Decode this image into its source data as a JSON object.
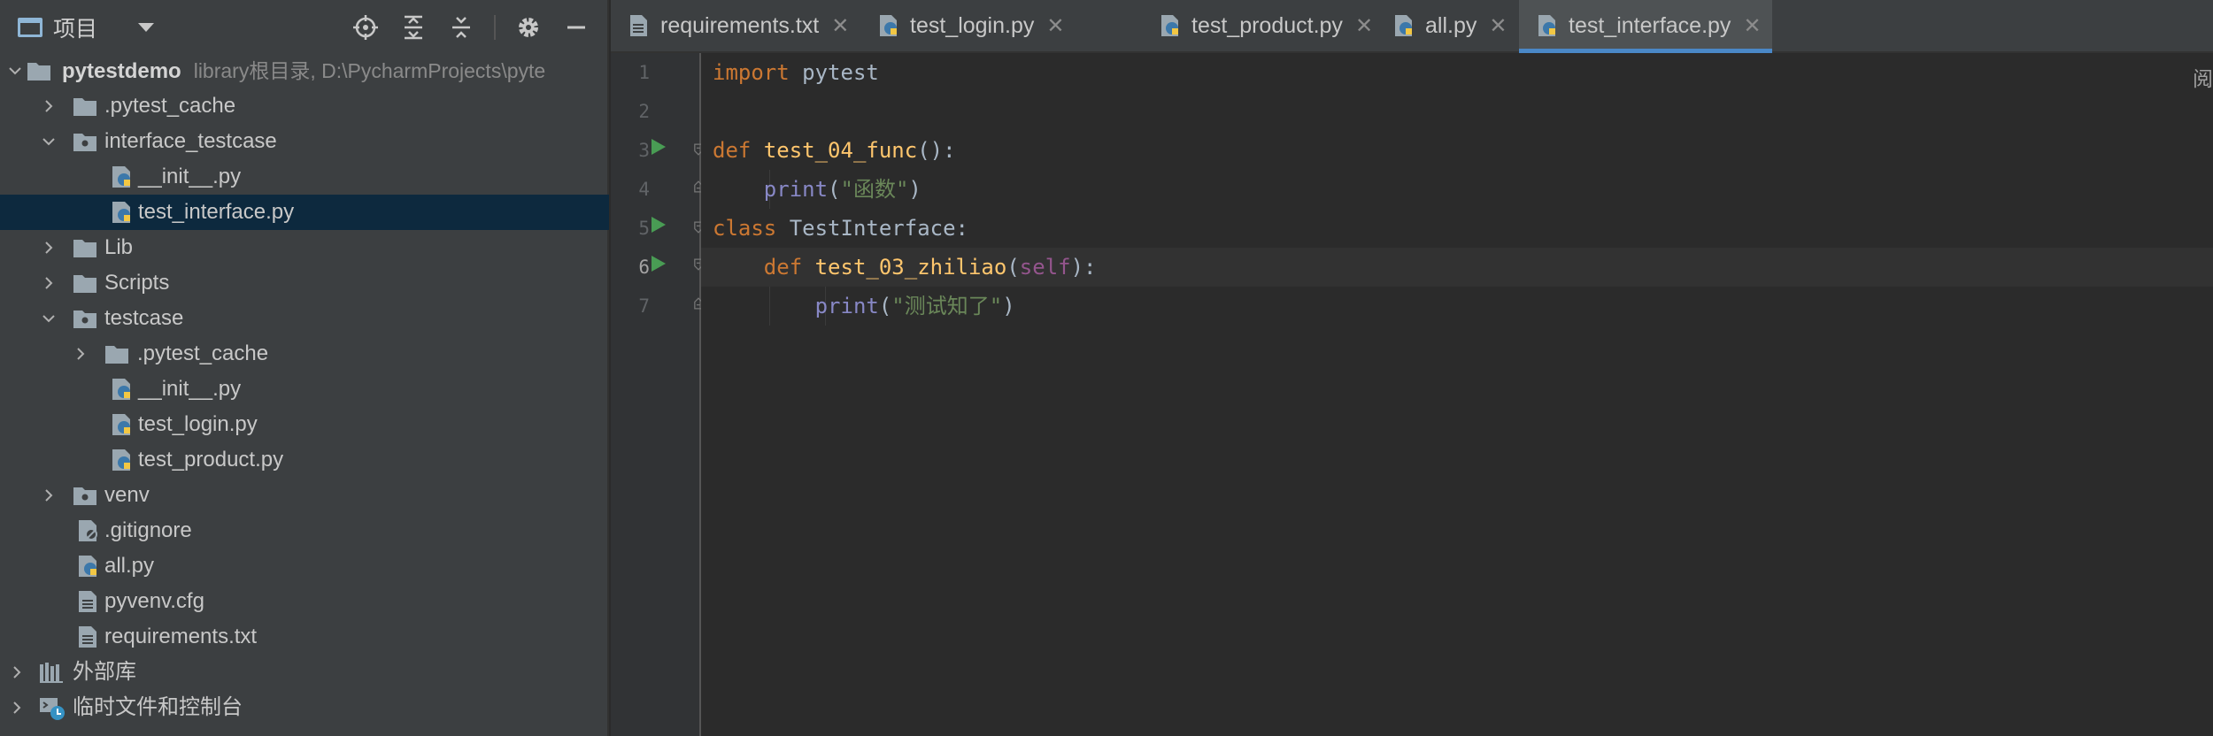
{
  "project_panel": {
    "title": "项目",
    "tools": [
      "locate-icon",
      "expand-all-icon",
      "collapse-all-icon",
      "gear-icon",
      "minimize-icon"
    ],
    "tree": [
      {
        "label": "pytestdemo",
        "path": "library根目录,  D:\\PycharmProjects\\pyte",
        "icon": "folder",
        "expanded": true,
        "bold": true
      },
      {
        "label": ".pytest_cache",
        "icon": "folder",
        "expanded": false
      },
      {
        "label": "interface_testcase",
        "icon": "package-folder",
        "expanded": true
      },
      {
        "label": "__init__.py",
        "icon": "python-file"
      },
      {
        "label": "test_interface.py",
        "icon": "python-file",
        "selected": true
      },
      {
        "label": "Lib",
        "icon": "folder",
        "expanded": false
      },
      {
        "label": "Scripts",
        "icon": "folder",
        "expanded": false
      },
      {
        "label": "testcase",
        "icon": "package-folder",
        "expanded": true
      },
      {
        "label": ".pytest_cache",
        "icon": "folder",
        "expanded": false
      },
      {
        "label": "__init__.py",
        "icon": "python-file"
      },
      {
        "label": "test_login.py",
        "icon": "python-file"
      },
      {
        "label": "test_product.py",
        "icon": "python-file"
      },
      {
        "label": "venv",
        "icon": "package-folder",
        "expanded": false
      },
      {
        "label": ".gitignore",
        "icon": "ignore-file"
      },
      {
        "label": "all.py",
        "icon": "python-file"
      },
      {
        "label": "pyvenv.cfg",
        "icon": "text-file"
      },
      {
        "label": "requirements.txt",
        "icon": "text-file"
      },
      {
        "label": "外部库",
        "icon": "library",
        "expanded": false
      },
      {
        "label": "临时文件和控制台",
        "icon": "scratches",
        "expanded": false
      }
    ]
  },
  "tabs": [
    {
      "label": "requirements.txt",
      "icon": "text-file",
      "active": false
    },
    {
      "label": "test_login.py",
      "icon": "python-file",
      "active": false
    },
    {
      "label": "test_product.py",
      "icon": "python-file",
      "active": false
    },
    {
      "label": "all.py",
      "icon": "python-file",
      "active": false
    },
    {
      "label": "test_interface.py",
      "icon": "python-file",
      "active": true
    }
  ],
  "tab_close_glyph": "✕",
  "editor": {
    "line_numbers": [
      "1",
      "2",
      "3",
      "4",
      "5",
      "6",
      "7"
    ],
    "current_line": 6,
    "run_markers": [
      3,
      5,
      6
    ],
    "code": {
      "l1_kw": "import",
      "l1_rest": " pytest",
      "l3_kw": "def ",
      "l3_fn": "test_04_func",
      "l3_rest": "():",
      "l4_indent": "    ",
      "l4_fn": "print",
      "l4_p1": "(",
      "l4_str": "\"函数\"",
      "l4_p2": ")",
      "l5_kw": "class ",
      "l5_rest": "TestInterface:",
      "l6_indent": "    ",
      "l6_kw": "def ",
      "l6_fn": "test_03_zhiliao",
      "l6_p1": "(",
      "l6_self": "self",
      "l6_p2": "):",
      "l7_indent": "        ",
      "l7_fn": "print",
      "l7_p1": "(",
      "l7_str": "\"测试知了\"",
      "l7_p2": ")"
    },
    "right_edge_text": "阅"
  },
  "colors": {
    "accent": "#4a88c7",
    "run": "#499c54",
    "selection": "#0d293e"
  }
}
